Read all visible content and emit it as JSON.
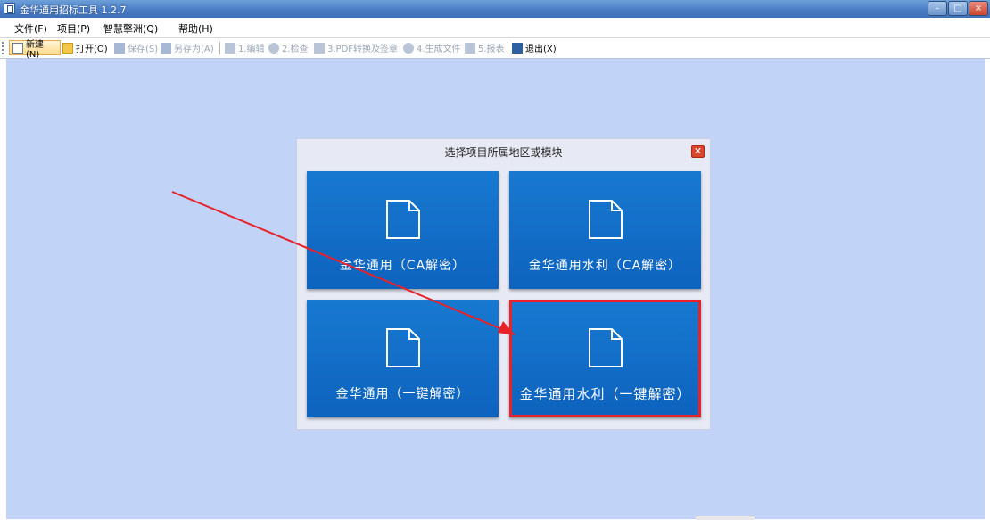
{
  "window": {
    "title": "金华通用招标工具 1.2.7",
    "controls": [
      "–",
      "□",
      "×"
    ]
  },
  "menu": {
    "items": [
      "文件(F)",
      "项目(P)",
      "智慧擎洲(Q)",
      "帮助(H)"
    ]
  },
  "toolbar": {
    "new": "新建(N)",
    "open": "打开(O)",
    "save": "保存(S)",
    "save_as": "另存为(A)",
    "edit": "1.编辑",
    "check": "2.检查",
    "pdf": "3.PDF转换及签章",
    "generate": "4.生成文件",
    "report": "5.报表",
    "exit": "退出(X)"
  },
  "dialog": {
    "title": "选择项目所属地区或模块",
    "close_icon": "close-icon",
    "tiles": [
      {
        "label": "金华通用（CA解密）",
        "icon": "file-icon"
      },
      {
        "label": "金华通用水利（CA解密）",
        "icon": "file-icon"
      },
      {
        "label": "金华通用（一键解密）",
        "icon": "file-icon"
      },
      {
        "label": "金华通用水利（一键解密）",
        "icon": "file-icon",
        "highlighted": true
      }
    ]
  },
  "colors": {
    "client_bg": "#c1d3f6",
    "tile_bg": "#1170c8",
    "highlight": "#e8212a",
    "arrow": "#e8212a"
  }
}
